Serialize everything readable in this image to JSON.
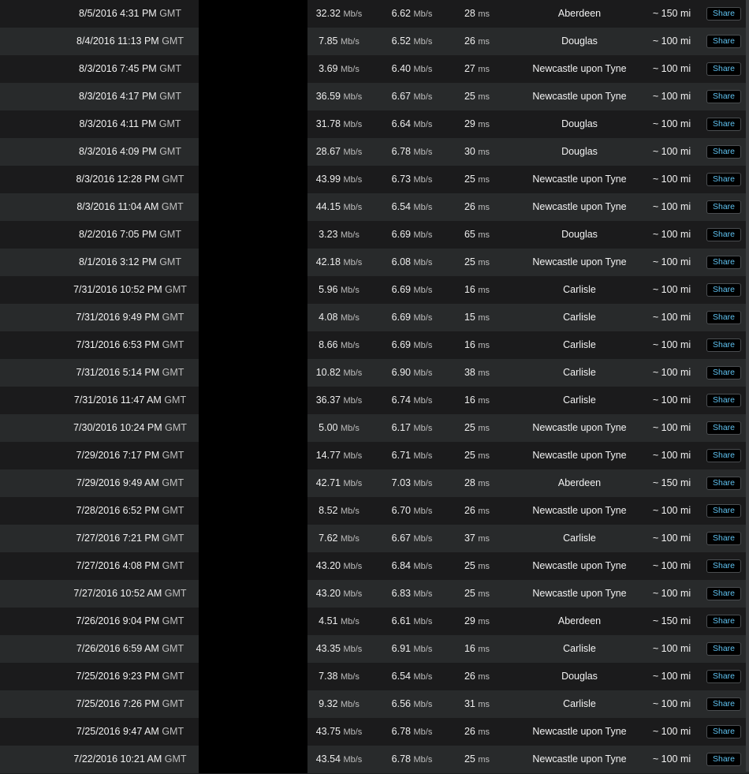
{
  "units": {
    "speed": "Mb/s",
    "ping": "ms",
    "timezone": "GMT"
  },
  "share_label": "Share",
  "results": [
    {
      "date": "8/5/2016 4:31 PM",
      "download": "32.32",
      "upload": "6.62",
      "ping": "28",
      "server": "Aberdeen",
      "distance": "~ 150 mi"
    },
    {
      "date": "8/4/2016 11:13 PM",
      "download": "7.85",
      "upload": "6.52",
      "ping": "26",
      "server": "Douglas",
      "distance": "~ 100 mi"
    },
    {
      "date": "8/3/2016 7:45 PM",
      "download": "3.69",
      "upload": "6.40",
      "ping": "27",
      "server": "Newcastle upon Tyne",
      "distance": "~ 100 mi"
    },
    {
      "date": "8/3/2016 4:17 PM",
      "download": "36.59",
      "upload": "6.67",
      "ping": "25",
      "server": "Newcastle upon Tyne",
      "distance": "~ 100 mi"
    },
    {
      "date": "8/3/2016 4:11 PM",
      "download": "31.78",
      "upload": "6.64",
      "ping": "29",
      "server": "Douglas",
      "distance": "~ 100 mi"
    },
    {
      "date": "8/3/2016 4:09 PM",
      "download": "28.67",
      "upload": "6.78",
      "ping": "30",
      "server": "Douglas",
      "distance": "~ 100 mi"
    },
    {
      "date": "8/3/2016 12:28 PM",
      "download": "43.99",
      "upload": "6.73",
      "ping": "25",
      "server": "Newcastle upon Tyne",
      "distance": "~ 100 mi"
    },
    {
      "date": "8/3/2016 11:04 AM",
      "download": "44.15",
      "upload": "6.54",
      "ping": "26",
      "server": "Newcastle upon Tyne",
      "distance": "~ 100 mi"
    },
    {
      "date": "8/2/2016 7:05 PM",
      "download": "3.23",
      "upload": "6.69",
      "ping": "65",
      "server": "Douglas",
      "distance": "~ 100 mi"
    },
    {
      "date": "8/1/2016 3:12 PM",
      "download": "42.18",
      "upload": "6.08",
      "ping": "25",
      "server": "Newcastle upon Tyne",
      "distance": "~ 100 mi"
    },
    {
      "date": "7/31/2016 10:52 PM",
      "download": "5.96",
      "upload": "6.69",
      "ping": "16",
      "server": "Carlisle",
      "distance": "~ 100 mi"
    },
    {
      "date": "7/31/2016 9:49 PM",
      "download": "4.08",
      "upload": "6.69",
      "ping": "15",
      "server": "Carlisle",
      "distance": "~ 100 mi"
    },
    {
      "date": "7/31/2016 6:53 PM",
      "download": "8.66",
      "upload": "6.69",
      "ping": "16",
      "server": "Carlisle",
      "distance": "~ 100 mi"
    },
    {
      "date": "7/31/2016 5:14 PM",
      "download": "10.82",
      "upload": "6.90",
      "ping": "38",
      "server": "Carlisle",
      "distance": "~ 100 mi"
    },
    {
      "date": "7/31/2016 11:47 AM",
      "download": "36.37",
      "upload": "6.74",
      "ping": "16",
      "server": "Carlisle",
      "distance": "~ 100 mi"
    },
    {
      "date": "7/30/2016 10:24 PM",
      "download": "5.00",
      "upload": "6.17",
      "ping": "25",
      "server": "Newcastle upon Tyne",
      "distance": "~ 100 mi"
    },
    {
      "date": "7/29/2016 7:17 PM",
      "download": "14.77",
      "upload": "6.71",
      "ping": "25",
      "server": "Newcastle upon Tyne",
      "distance": "~ 100 mi"
    },
    {
      "date": "7/29/2016 9:49 AM",
      "download": "42.71",
      "upload": "7.03",
      "ping": "28",
      "server": "Aberdeen",
      "distance": "~ 150 mi"
    },
    {
      "date": "7/28/2016 6:52 PM",
      "download": "8.52",
      "upload": "6.70",
      "ping": "26",
      "server": "Newcastle upon Tyne",
      "distance": "~ 100 mi"
    },
    {
      "date": "7/27/2016 7:21 PM",
      "download": "7.62",
      "upload": "6.67",
      "ping": "37",
      "server": "Carlisle",
      "distance": "~ 100 mi"
    },
    {
      "date": "7/27/2016 4:08 PM",
      "download": "43.20",
      "upload": "6.84",
      "ping": "25",
      "server": "Newcastle upon Tyne",
      "distance": "~ 100 mi"
    },
    {
      "date": "7/27/2016 10:52 AM",
      "download": "43.20",
      "upload": "6.83",
      "ping": "25",
      "server": "Newcastle upon Tyne",
      "distance": "~ 100 mi"
    },
    {
      "date": "7/26/2016 9:04 PM",
      "download": "4.51",
      "upload": "6.61",
      "ping": "29",
      "server": "Aberdeen",
      "distance": "~ 150 mi"
    },
    {
      "date": "7/26/2016 6:59 AM",
      "download": "43.35",
      "upload": "6.91",
      "ping": "16",
      "server": "Carlisle",
      "distance": "~ 100 mi"
    },
    {
      "date": "7/25/2016 9:23 PM",
      "download": "7.38",
      "upload": "6.54",
      "ping": "26",
      "server": "Douglas",
      "distance": "~ 100 mi"
    },
    {
      "date": "7/25/2016 7:26 PM",
      "download": "9.32",
      "upload": "6.56",
      "ping": "31",
      "server": "Carlisle",
      "distance": "~ 100 mi"
    },
    {
      "date": "7/25/2016 9:47 AM",
      "download": "43.75",
      "upload": "6.78",
      "ping": "26",
      "server": "Newcastle upon Tyne",
      "distance": "~ 100 mi"
    },
    {
      "date": "7/22/2016 10:21 AM",
      "download": "43.54",
      "upload": "6.78",
      "ping": "25",
      "server": "Newcastle upon Tyne",
      "distance": "~ 100 mi"
    }
  ]
}
